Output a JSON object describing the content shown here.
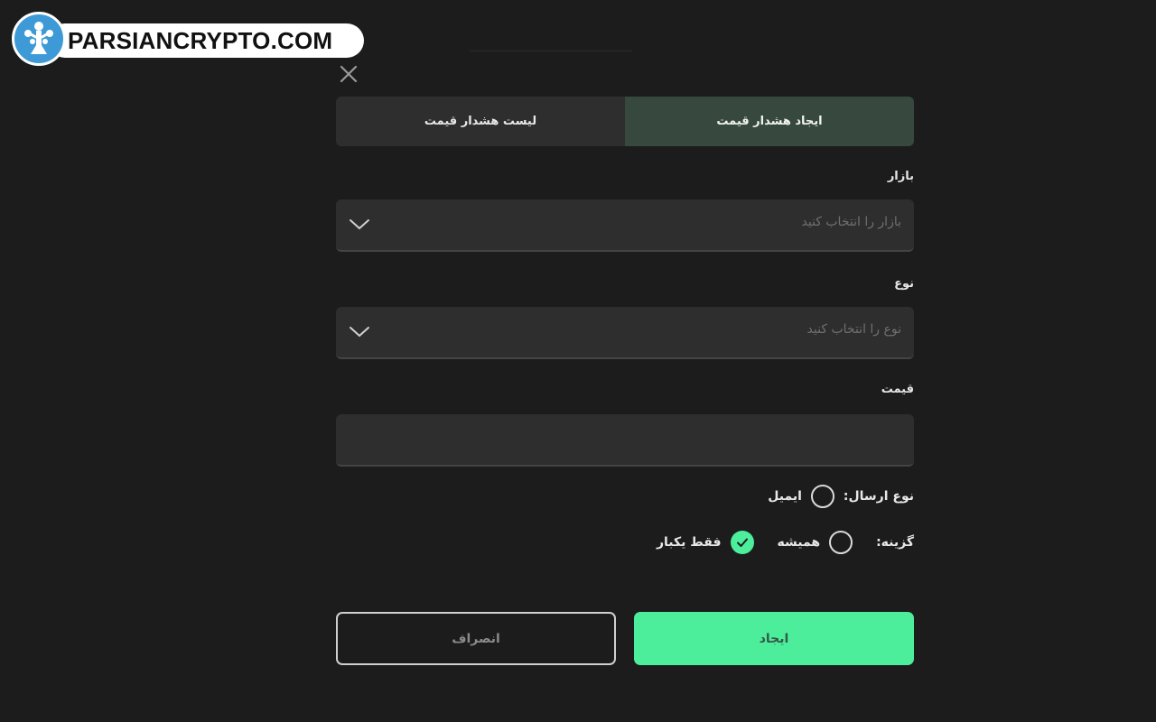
{
  "watermark": {
    "text": "PARSIANCRYPTO.COM",
    "logo_icon": "tree-logo-icon",
    "colors": {
      "circle": "#3d9ad6",
      "pill": "#ffffff"
    }
  },
  "dialog": {
    "close_icon": "close-icon",
    "tabs": [
      {
        "label": "ایجاد هشدار قیمت",
        "active": true
      },
      {
        "label": "لیست هشدار قیمت",
        "active": false
      }
    ],
    "market": {
      "label": "بازار",
      "placeholder": "بازار را انتخاب کنید",
      "icon": "chevron-down-icon"
    },
    "type": {
      "label": "نوع",
      "placeholder": "نوع را انتخاب کنید",
      "icon": "chevron-down-icon"
    },
    "price": {
      "label": "قیمت",
      "value": ""
    },
    "send_type": {
      "label": "نوع ارسال:",
      "options": [
        {
          "label": "ایمیل",
          "checked": false
        }
      ]
    },
    "option": {
      "label": "گزینه:",
      "options": [
        {
          "label": "همیشه",
          "checked": false
        },
        {
          "label": "فقط یکبار",
          "checked": true
        }
      ]
    },
    "buttons": {
      "create": "ایجاد",
      "cancel": "انصراف"
    }
  },
  "colors": {
    "background": "#1c1c1c",
    "surface": "#2e2e2e",
    "active_tab": "#37493f",
    "accent": "#4cee9c"
  }
}
